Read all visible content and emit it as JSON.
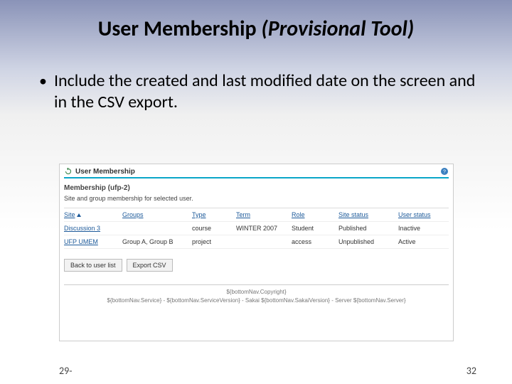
{
  "title": {
    "main": "User Membership ",
    "italic": "(Provisional Tool)"
  },
  "bullet": "Include the created and last modified date on the screen and in the CSV export.",
  "panel": {
    "header": "User Membership",
    "section_title": "Membership (ufp-2)",
    "section_desc": "Site and group membership for selected user.",
    "columns": {
      "site": "Site",
      "groups": "Groups",
      "type": "Type",
      "term": "Term",
      "role": "Role",
      "site_status": "Site status",
      "user_status": "User status"
    },
    "rows": [
      {
        "site": "Discussion 3",
        "groups": "",
        "type": "course",
        "term": "WINTER 2007",
        "role": "Student",
        "site_status": "Published",
        "user_status": "Inactive"
      },
      {
        "site": "UFP UMEM",
        "groups": "Group A, Group B",
        "type": "project",
        "term": "",
        "role": "access",
        "site_status": "Unpublished",
        "user_status": "Active"
      }
    ],
    "buttons": {
      "back": "Back to user list",
      "export": "Export CSV"
    },
    "footer": {
      "l1": "${bottomNav.Copyright}",
      "l2": "${bottomNav.Service} - ${bottomNav.ServiceVersion} - Sakai ${bottomNav.SakaiVersion} - Server ${bottomNav.Server}"
    }
  },
  "slide_footer": {
    "left": "29-",
    "right": "32"
  }
}
